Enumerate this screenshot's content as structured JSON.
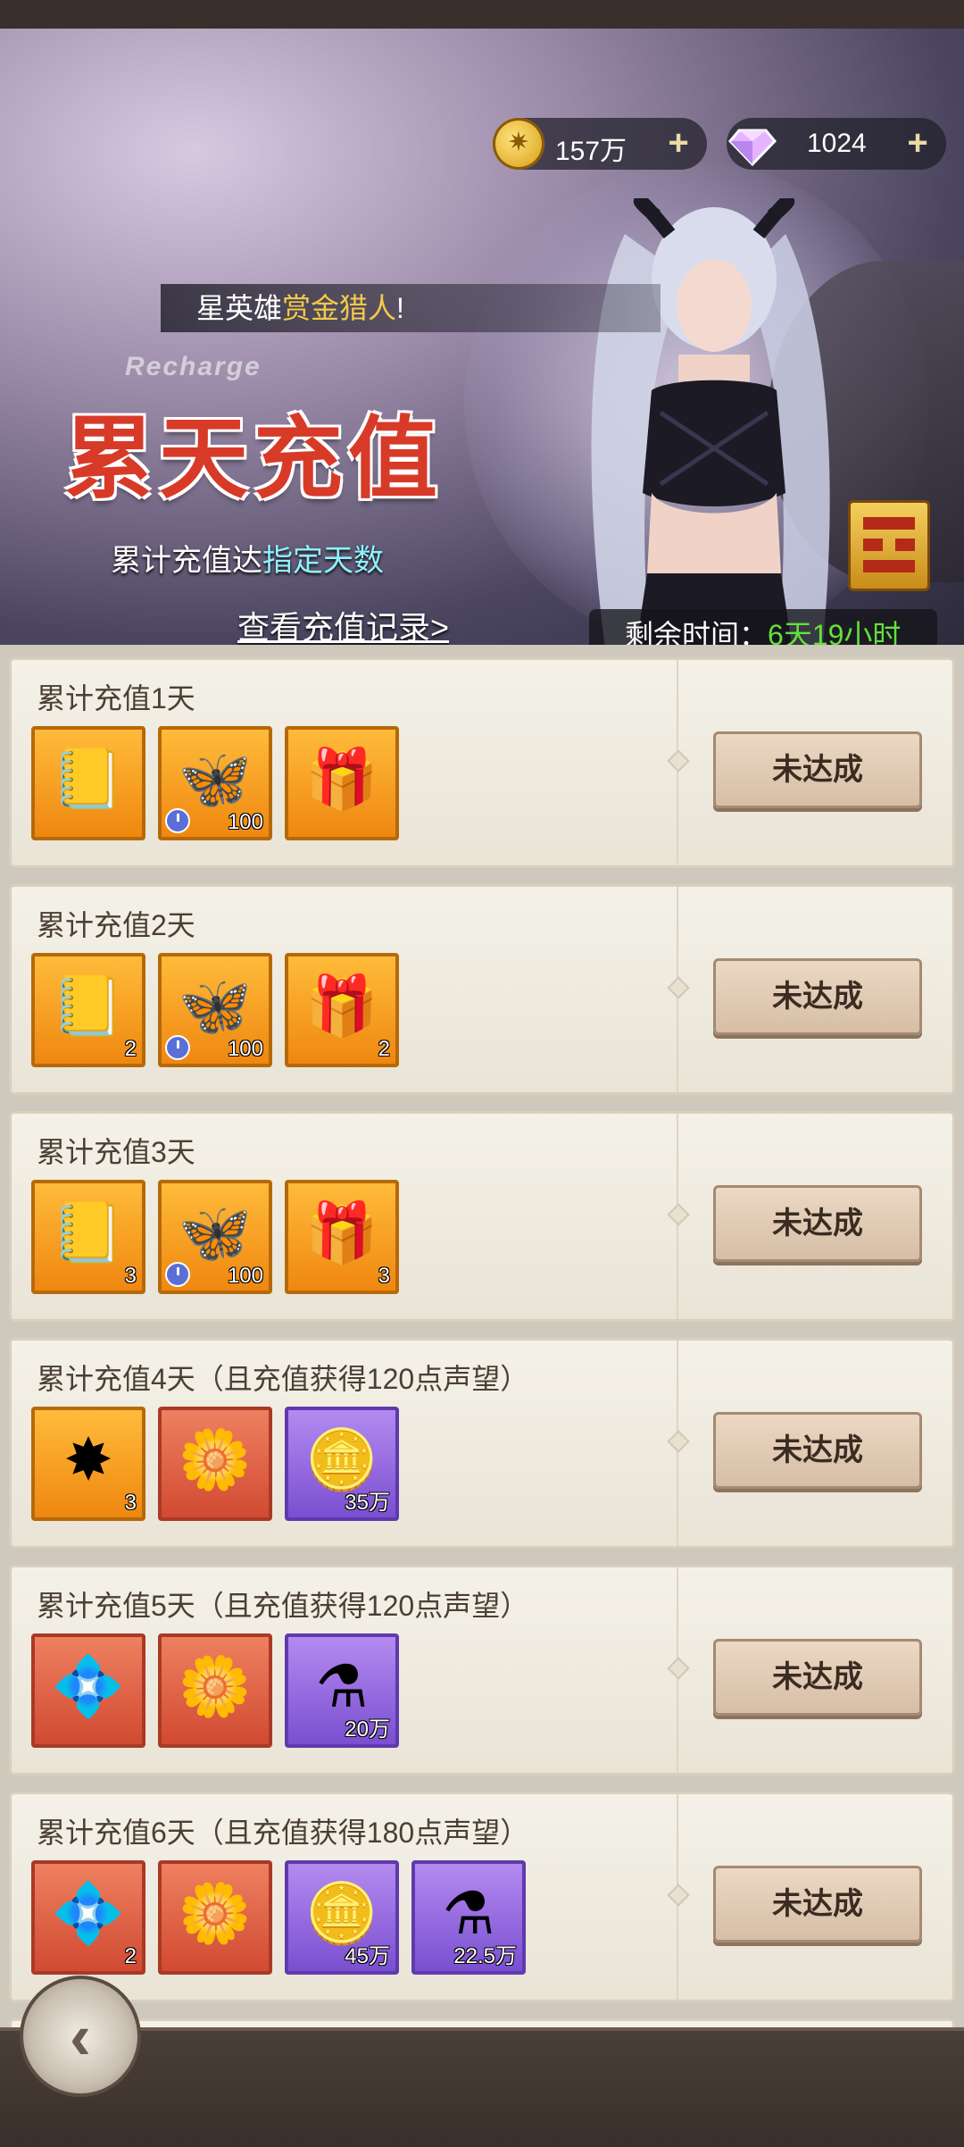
{
  "resources": {
    "gold": {
      "icon": "gold-coin-icon",
      "value": "157万"
    },
    "diamond": {
      "icon": "diamond-icon",
      "value": "1024"
    }
  },
  "notice": {
    "prefix": "星英雄",
    "highlight": "赏金猎人",
    "suffix": "!"
  },
  "event": {
    "subtitle": "Recharge",
    "title": "累天充值",
    "desc_prefix": "累计充值达",
    "desc_highlight": "指定天数",
    "history_link": "查看充值记录>",
    "timer_label": "剩余时间：",
    "timer_value": "6天19小时"
  },
  "colors": {
    "highlight_gold": "#f3c94a",
    "highlight_cyan": "#8ef2ff",
    "timer_green": "#63e23a"
  },
  "tasks": [
    {
      "title": "累计充值1天",
      "button": "未达成",
      "rewards": [
        {
          "type": "book",
          "rarity": "orange",
          "count": ""
        },
        {
          "type": "butterfly",
          "rarity": "orange",
          "count": "100",
          "timed": true
        },
        {
          "type": "chest",
          "rarity": "orange",
          "count": ""
        }
      ]
    },
    {
      "title": "累计充值2天",
      "button": "未达成",
      "rewards": [
        {
          "type": "book",
          "rarity": "orange",
          "count": "2"
        },
        {
          "type": "butterfly",
          "rarity": "orange",
          "count": "100",
          "timed": true
        },
        {
          "type": "chest",
          "rarity": "orange",
          "count": "2"
        }
      ]
    },
    {
      "title": "累计充值3天",
      "button": "未达成",
      "rewards": [
        {
          "type": "book",
          "rarity": "orange",
          "count": "3"
        },
        {
          "type": "butterfly",
          "rarity": "orange",
          "count": "100",
          "timed": true
        },
        {
          "type": "chest",
          "rarity": "orange",
          "count": "3"
        }
      ]
    },
    {
      "title": "累计充值4天（且充值获得120点声望）",
      "button": "未达成",
      "rewards": [
        {
          "type": "sun-gem",
          "rarity": "orange",
          "count": "3"
        },
        {
          "type": "flower",
          "rarity": "red",
          "count": ""
        },
        {
          "type": "gold-coin",
          "rarity": "purple",
          "count": "35万"
        }
      ]
    },
    {
      "title": "累计充值5天（且充值获得120点声望）",
      "button": "未达成",
      "rewards": [
        {
          "type": "crystal",
          "rarity": "red",
          "count": ""
        },
        {
          "type": "flower",
          "rarity": "red",
          "count": ""
        },
        {
          "type": "potion",
          "rarity": "purple",
          "count": "20万"
        }
      ]
    },
    {
      "title": "累计充值6天（且充值获得180点声望）",
      "button": "未达成",
      "rewards": [
        {
          "type": "crystal",
          "rarity": "red",
          "count": "2"
        },
        {
          "type": "flower",
          "rarity": "red",
          "count": ""
        },
        {
          "type": "gold-coin",
          "rarity": "purple",
          "count": "45万"
        },
        {
          "type": "potion",
          "rarity": "purple",
          "count": "22.5万"
        }
      ]
    }
  ]
}
